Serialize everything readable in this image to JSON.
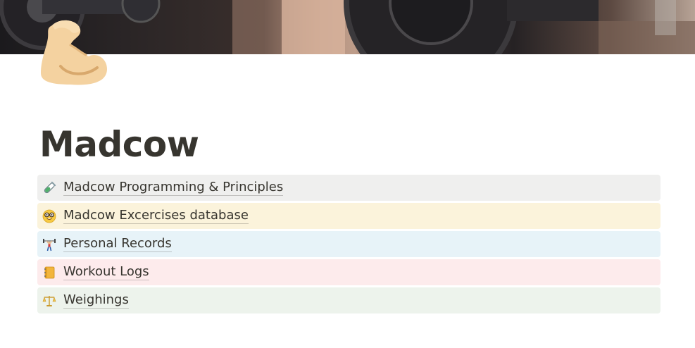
{
  "page": {
    "title": "Madcow",
    "icon": "flexed-biceps-icon"
  },
  "cover": {
    "description_icon": "barbell-cover-image"
  },
  "links": [
    {
      "label": "Madcow Programming & Principles",
      "icon": "test-tube-icon",
      "background": "#efefee"
    },
    {
      "label": "Madcow Excercises database",
      "icon": "nerd-face-icon",
      "background": "#fbf3db"
    },
    {
      "label": "Personal Records",
      "icon": "weightlifter-icon",
      "background": "#e7f3f8"
    },
    {
      "label": "Workout Logs",
      "icon": "notebook-icon",
      "background": "#fdebec"
    },
    {
      "label": "Weighings",
      "icon": "balance-scale-icon",
      "background": "#edf3ec"
    }
  ]
}
